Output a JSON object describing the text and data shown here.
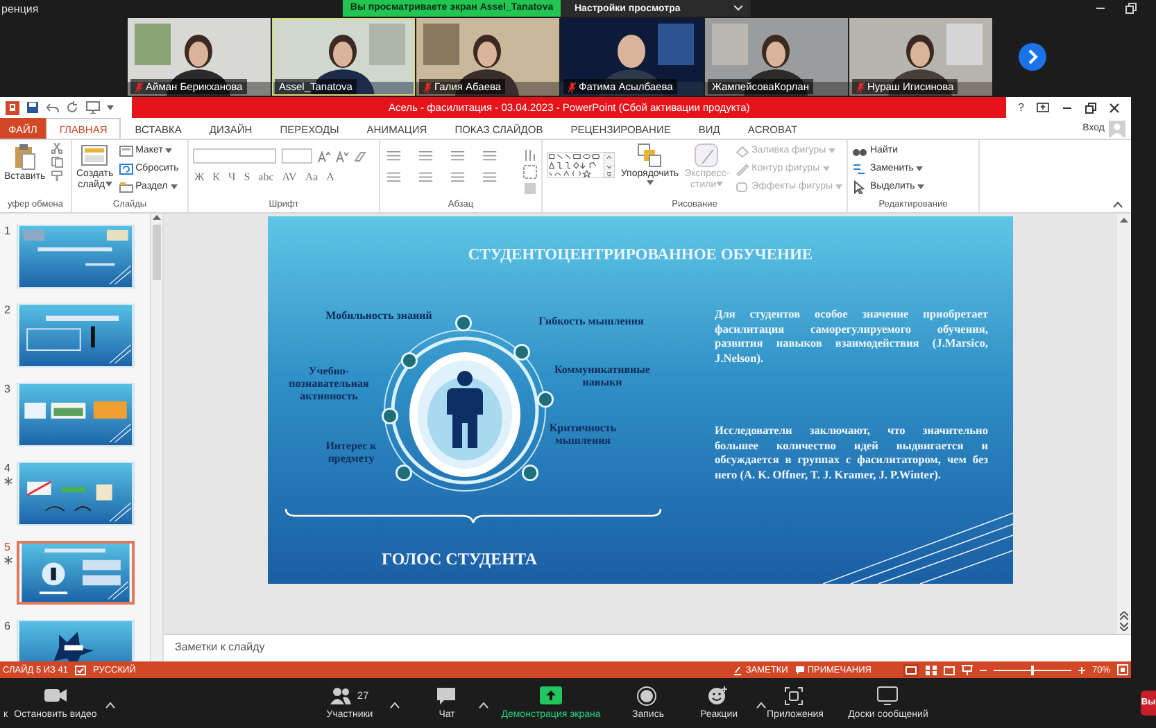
{
  "zoom_top": {
    "app_title": "ренция",
    "banner": "Вы просматриваете экран Assel_Tanatova",
    "view_options": "Настройки просмотра"
  },
  "participants": [
    {
      "name": "Айман Берикханова",
      "muted": true,
      "speaking": false
    },
    {
      "name": "Assel_Tanatova",
      "muted": false,
      "speaking": true
    },
    {
      "name": "Галия Абаева",
      "muted": true,
      "speaking": false
    },
    {
      "name": "Фатима Асылбаева",
      "muted": true,
      "speaking": false
    },
    {
      "name": "ЖампейсоваКорлан",
      "muted": false,
      "speaking": false
    },
    {
      "name": "Нураш Игисинова",
      "muted": true,
      "speaking": false
    }
  ],
  "powerpoint": {
    "title": "Асель - фасилитация - 03.04.2023 - PowerPoint (Сбой активации продукта)",
    "help": "?",
    "sign_in": "Вход",
    "tabs": [
      {
        "label": "ФАЙЛ",
        "kind": "file",
        "selected": false
      },
      {
        "label": "ГЛАВНАЯ",
        "kind": "tab",
        "selected": true
      },
      {
        "label": "ВСТАВКА",
        "kind": "tab",
        "selected": false
      },
      {
        "label": "ДИЗАЙН",
        "kind": "tab",
        "selected": false
      },
      {
        "label": "ПЕРЕХОДЫ",
        "kind": "tab",
        "selected": false
      },
      {
        "label": "АНИМАЦИЯ",
        "kind": "tab",
        "selected": false
      },
      {
        "label": "ПОКАЗ СЛАЙДОВ",
        "kind": "tab",
        "selected": false
      },
      {
        "label": "РЕЦЕНЗИРОВАНИЕ",
        "kind": "tab",
        "selected": false
      },
      {
        "label": "ВИД",
        "kind": "tab",
        "selected": false
      },
      {
        "label": "ACROBAT",
        "kind": "tab",
        "selected": false
      }
    ],
    "ribbon": [
      {
        "kind": "clipboard",
        "label": "уфер обмена",
        "paste": "Вставить"
      },
      {
        "kind": "slides",
        "label": "Слайды",
        "new_slide": [
          "Создать",
          "слайд"
        ],
        "buttons": [
          {
            "label": "Макет",
            "dropdown": true
          },
          {
            "label": "Сбросить",
            "dropdown": false
          },
          {
            "label": "Раздел",
            "dropdown": true
          }
        ]
      },
      {
        "kind": "font",
        "label": "Шрифт",
        "format_buttons": [
          "Ж",
          "К",
          "Ч",
          "S",
          "abc",
          "AV",
          "Aa",
          "A"
        ]
      },
      {
        "kind": "paragraph",
        "label": "Абзац"
      },
      {
        "kind": "drawing",
        "label": "Рисование",
        "arrange": "Упорядочить",
        "quick_styles": [
          "Экспресс-",
          "стили"
        ],
        "buttons": [
          {
            "label": "Заливка фигуры",
            "disabled": true,
            "dropdown": true
          },
          {
            "label": "Контур фигуры",
            "disabled": true,
            "dropdown": true
          },
          {
            "label": "Эффекты фигуры",
            "disabled": true,
            "dropdown": true
          }
        ]
      },
      {
        "kind": "editing",
        "label": "Редактирование",
        "buttons": [
          {
            "label": "Найти",
            "dropdown": false
          },
          {
            "label": "Заменить",
            "dropdown": true
          },
          {
            "label": "Выделить",
            "dropdown": true
          }
        ]
      }
    ]
  },
  "thumbnails": [
    {
      "number": "1",
      "starred": false,
      "selected": false
    },
    {
      "number": "2",
      "starred": false,
      "selected": false
    },
    {
      "number": "3",
      "starred": false,
      "selected": false
    },
    {
      "number": "4",
      "starred": true,
      "selected": false
    },
    {
      "number": "5",
      "starred": true,
      "selected": true
    },
    {
      "number": "6",
      "starred": false,
      "selected": false
    }
  ],
  "slide": {
    "title": "СТУДЕНТОЦЕНТРИРОВАННОЕ ОБУЧЕНИЕ",
    "qualities": [
      {
        "text": "Мобильность знаний"
      },
      {
        "text": "Гибкость мышления"
      },
      {
        "text": "Учебно-познавательная активность"
      },
      {
        "text": "Коммуникативные навыки"
      },
      {
        "text": "Критичность мышления"
      },
      {
        "text": "Интерес к предмету"
      }
    ],
    "caption": "ГОЛОС СТУДЕНТА",
    "paragraphs": [
      "Для студентов особое значение приобретает фасилитация саморегулируемого обучения, развития навыков взаимодействия (J.Marsico, J.Nelson).",
      "Исследователи заключают, что значительно большее количество идей выдвигается и обсуждается в группах с фасилитатором, чем без него (A. K. Offner, T. J. Kramer, J. P.Winter)."
    ]
  },
  "notes_placeholder": "Заметки к слайду",
  "status_bar": {
    "slide": "СЛАЙД 5 ИЗ 41",
    "language": "РУССКИЙ",
    "notes": "ЗАМЕТКИ",
    "comments": "ПРИМЕЧАНИЯ",
    "zoom_slider": {
      "level": 0.5
    },
    "zoom": "70%"
  },
  "toolbar": [
    {
      "kind": "audio",
      "label": "к"
    },
    {
      "kind": "video",
      "label": "Остановить видео"
    },
    {
      "kind": "participants",
      "label": "Участники",
      "count": "27"
    },
    {
      "kind": "chat",
      "label": "Чат"
    },
    {
      "kind": "share",
      "label": "Демонстрация экрана"
    },
    {
      "kind": "record",
      "label": "Запись"
    },
    {
      "kind": "reactions",
      "label": "Реакции"
    },
    {
      "kind": "apps",
      "label": "Приложения"
    },
    {
      "kind": "whiteboards",
      "label": "Доски сообщений"
    }
  ],
  "end_button": "Вы"
}
